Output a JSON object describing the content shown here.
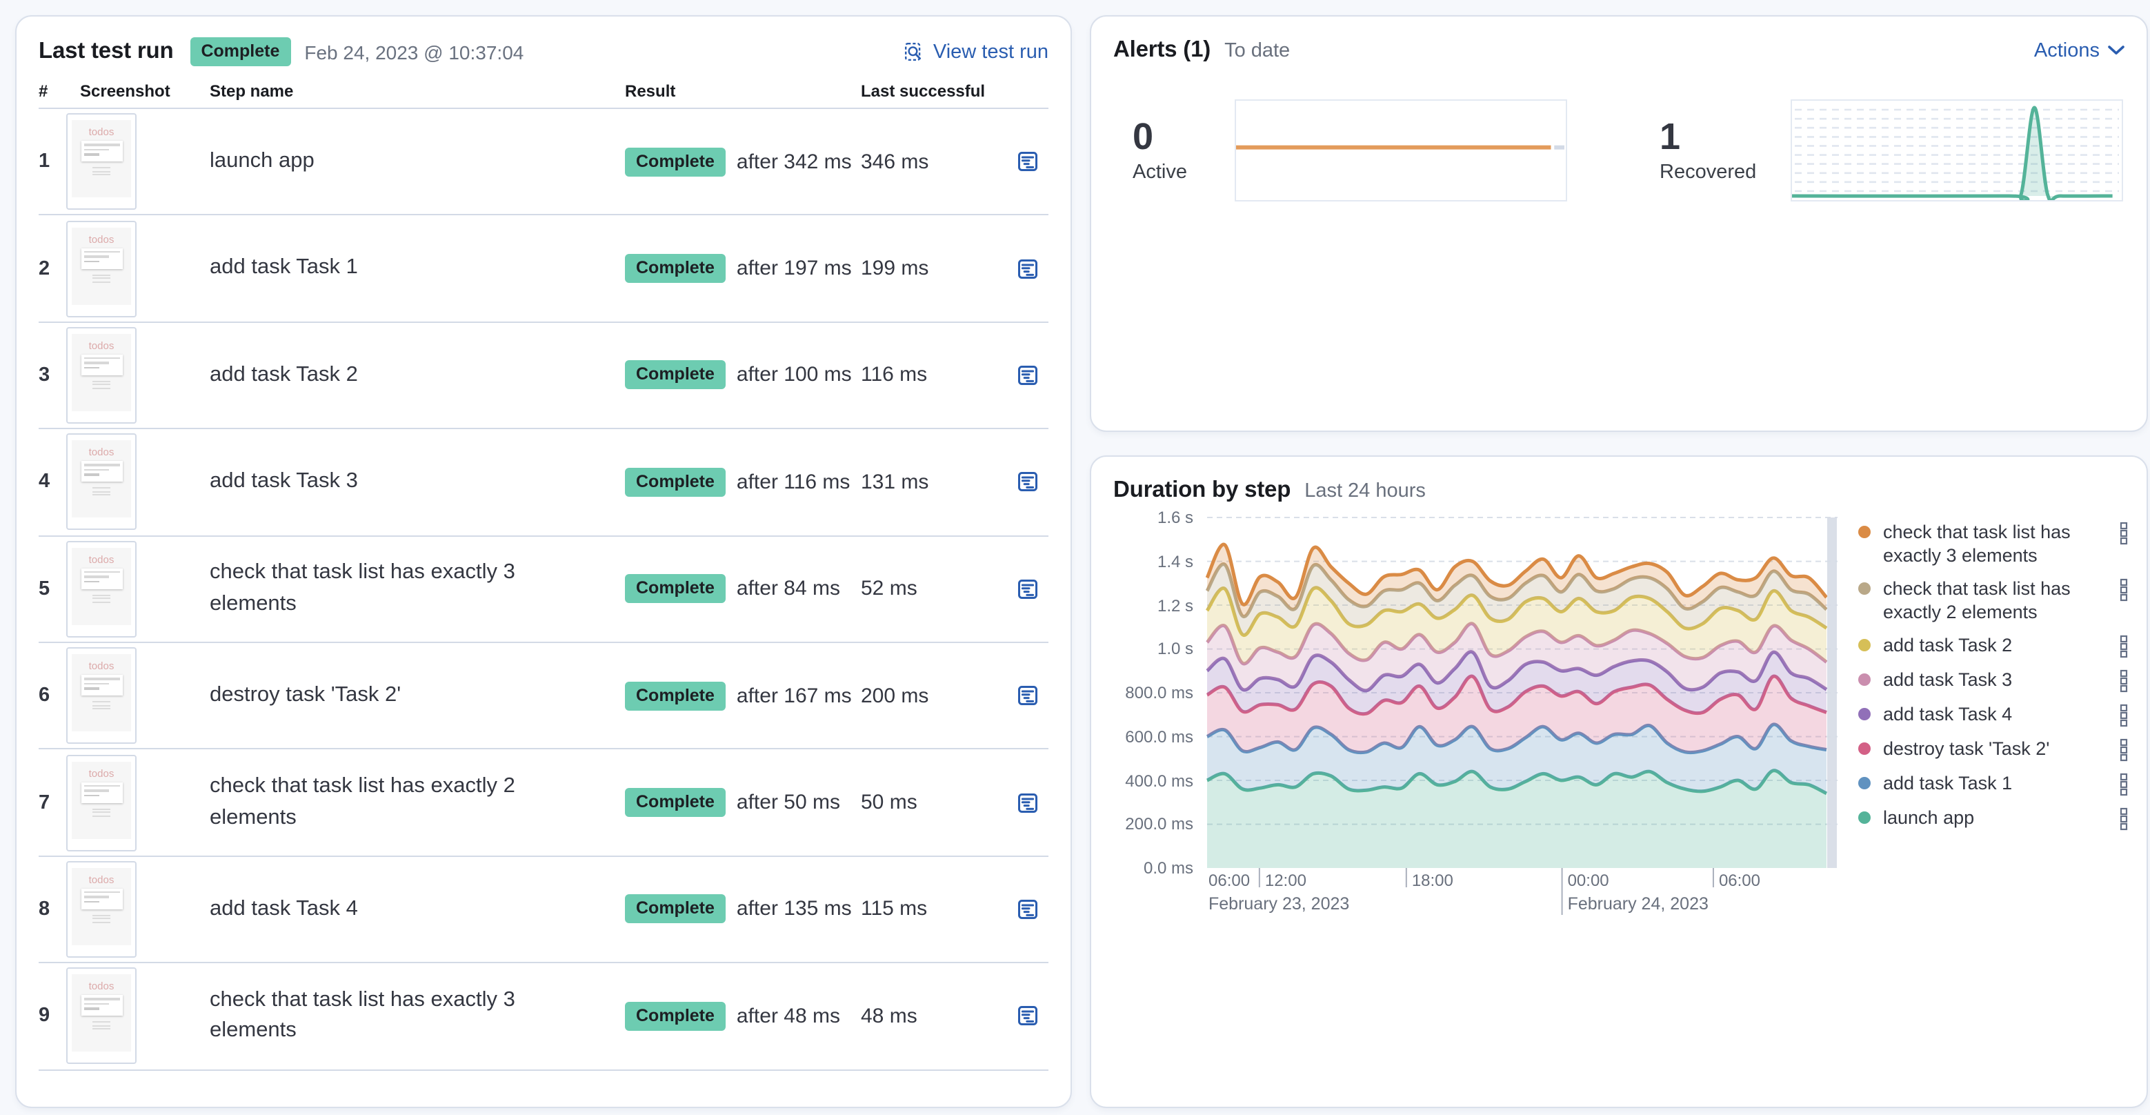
{
  "colors": {
    "badge_success_bg": "#6DCCB1",
    "link_blue": "#2A5DB0",
    "panel_border": "#DAE0EB",
    "divider": "#D3DAE6",
    "text": "#343741",
    "text_muted": "#69707D"
  },
  "last_test_run": {
    "title": "Last test run",
    "status_badge": "Complete",
    "timestamp": "Feb 24, 2023 @ 10:37:04",
    "view_test_run_label": "View test run",
    "table": {
      "headers": [
        "#",
        "Screenshot",
        "Step name",
        "Result",
        "Last successful"
      ],
      "thumbnail_title": "todos",
      "rows": [
        {
          "num": "1",
          "step": "launch app",
          "result": "Complete",
          "after": "after 342 ms",
          "last_successful": "346 ms"
        },
        {
          "num": "2",
          "step": "add task Task 1",
          "result": "Complete",
          "after": "after 197 ms",
          "last_successful": "199 ms"
        },
        {
          "num": "3",
          "step": "add task Task 2",
          "result": "Complete",
          "after": "after 100 ms",
          "last_successful": "116 ms"
        },
        {
          "num": "4",
          "step": "add task Task 3",
          "result": "Complete",
          "after": "after 116 ms",
          "last_successful": "131 ms"
        },
        {
          "num": "5",
          "step": "check that task list has exactly 3 elements",
          "result": "Complete",
          "after": "after 84 ms",
          "last_successful": "52 ms"
        },
        {
          "num": "6",
          "step": "destroy task 'Task 2'",
          "result": "Complete",
          "after": "after 167 ms",
          "last_successful": "200 ms"
        },
        {
          "num": "7",
          "step": "check that task list has exactly 2 elements",
          "result": "Complete",
          "after": "after 50 ms",
          "last_successful": "50 ms"
        },
        {
          "num": "8",
          "step": "add task Task 4",
          "result": "Complete",
          "after": "after 135 ms",
          "last_successful": "115 ms"
        },
        {
          "num": "9",
          "step": "check that task list has exactly 3 elements",
          "result": "Complete",
          "after": "after 48 ms",
          "last_successful": "48 ms"
        }
      ]
    }
  },
  "alerts": {
    "title": "Alerts (1)",
    "subtitle": "To date",
    "actions_label": "Actions",
    "stats": [
      {
        "value": "0",
        "label": "Active",
        "chart": {
          "shape": "flat",
          "color": "#E39B5B",
          "grid": false
        }
      },
      {
        "value": "1",
        "label": "Recovered",
        "chart": {
          "shape": "spike",
          "color": "#54B399",
          "grid": true,
          "spike_fraction": 0.74
        }
      }
    ]
  },
  "duration": {
    "title": "Duration by step",
    "subtitle": "Last 24 hours",
    "chart_data": {
      "type": "area",
      "stacked": true,
      "title": "Duration by step",
      "legend_position": "right",
      "grid": "dashed-horizontal",
      "y_axis": {
        "min": 0,
        "max": 1600,
        "unit": "ms",
        "ticks": [
          {
            "v": 0,
            "label": "0.0 ms"
          },
          {
            "v": 200,
            "label": "200.0 ms"
          },
          {
            "v": 400,
            "label": "400.0 ms"
          },
          {
            "v": 600,
            "label": "600.0 ms"
          },
          {
            "v": 800,
            "label": "800.0 ms"
          },
          {
            "v": 1000,
            "label": "1.0 s"
          },
          {
            "v": 1200,
            "label": "1.2 s"
          },
          {
            "v": 1400,
            "label": "1.4 s"
          },
          {
            "v": 1600,
            "label": "1.6 s"
          }
        ]
      },
      "x_axis": {
        "ticks": [
          {
            "label": "06:00",
            "fraction": 0,
            "tick": false
          },
          {
            "label": "12:00",
            "fraction": 0.083,
            "tick": true
          },
          {
            "label": "18:00",
            "fraction": 0.316,
            "tick": true
          },
          {
            "label": "00:00",
            "fraction": 0.563,
            "tick": true,
            "tall": true
          },
          {
            "label": "06:00",
            "fraction": 0.803,
            "tick": true
          }
        ],
        "date_labels": [
          {
            "text": "February 23, 2023",
            "fraction": 0
          },
          {
            "text": "February 24, 2023",
            "fraction": 0.563
          }
        ]
      },
      "series": [
        {
          "name": "launch app",
          "color": "#54B399",
          "values": [
            400,
            430,
            360,
            365,
            380,
            370,
            430,
            420,
            360,
            355,
            370,
            365,
            430,
            380,
            395,
            440,
            370,
            360,
            395,
            430,
            400,
            415,
            380,
            430,
            415,
            440,
            390,
            360,
            350,
            370,
            400,
            360,
            445,
            390,
            380,
            340
          ]
        },
        {
          "name": "add task Task 1",
          "color": "#6092C0",
          "values": [
            200,
            200,
            175,
            185,
            195,
            170,
            210,
            190,
            180,
            175,
            200,
            185,
            215,
            180,
            190,
            205,
            175,
            185,
            200,
            215,
            185,
            200,
            190,
            180,
            195,
            210,
            180,
            170,
            185,
            195,
            200,
            185,
            210,
            190,
            175,
            200
          ]
        },
        {
          "name": "destroy task 'Task 2'",
          "color": "#D36086",
          "values": [
            190,
            195,
            180,
            195,
            170,
            185,
            200,
            220,
            190,
            175,
            195,
            205,
            185,
            170,
            195,
            230,
            180,
            190,
            210,
            185,
            200,
            190,
            180,
            195,
            215,
            185,
            200,
            190,
            175,
            205,
            190,
            180,
            220,
            195,
            185,
            170
          ]
        },
        {
          "name": "add task Task 4",
          "color": "#9170B8",
          "values": [
            110,
            130,
            100,
            120,
            115,
            105,
            125,
            110,
            130,
            105,
            115,
            120,
            100,
            115,
            130,
            110,
            105,
            120,
            125,
            110,
            115,
            105,
            130,
            115,
            120,
            110,
            125,
            100,
            115,
            120,
            105,
            130,
            110,
            115,
            125,
            105
          ]
        },
        {
          "name": "add task Task 3",
          "color": "#CA8EAE",
          "values": [
            130,
            150,
            120,
            140,
            125,
            135,
            145,
            130,
            120,
            140,
            150,
            125,
            135,
            140,
            120,
            130,
            145,
            135,
            125,
            140,
            130,
            150,
            135,
            120,
            140,
            125,
            130,
            145,
            135,
            125,
            140,
            130,
            120,
            150,
            135,
            125
          ]
        },
        {
          "name": "add task Task 2",
          "color": "#D6BF57",
          "values": [
            145,
            170,
            130,
            155,
            160,
            140,
            165,
            150,
            135,
            160,
            145,
            170,
            140,
            155,
            150,
            130,
            165,
            145,
            160,
            150,
            140,
            170,
            155,
            135,
            150,
            160,
            145,
            130,
            155,
            170,
            140,
            150,
            160,
            135,
            145,
            155
          ]
        },
        {
          "name": "check that task list has exactly 2 elements",
          "color": "#B9A888",
          "values": [
            90,
            110,
            85,
            100,
            95,
            80,
            105,
            95,
            110,
            85,
            90,
            100,
            95,
            80,
            110,
            90,
            100,
            95,
            85,
            105,
            90,
            110,
            95,
            100,
            85,
            95,
            105,
            90,
            100,
            95,
            85,
            110,
            90,
            95,
            105,
            85
          ]
        },
        {
          "name": "check that task list has exactly 3 elements",
          "color": "#DA8B45",
          "values": [
            60,
            90,
            55,
            70,
            65,
            50,
            80,
            60,
            75,
            55,
            65,
            70,
            60,
            50,
            85,
            65,
            70,
            60,
            55,
            75,
            65,
            85,
            60,
            70,
            55,
            65,
            75,
            60,
            70,
            65,
            55,
            80,
            60,
            65,
            75,
            55
          ]
        }
      ],
      "legend_note": "legend rendered top-to-bottom is reverse of stacking order"
    }
  }
}
